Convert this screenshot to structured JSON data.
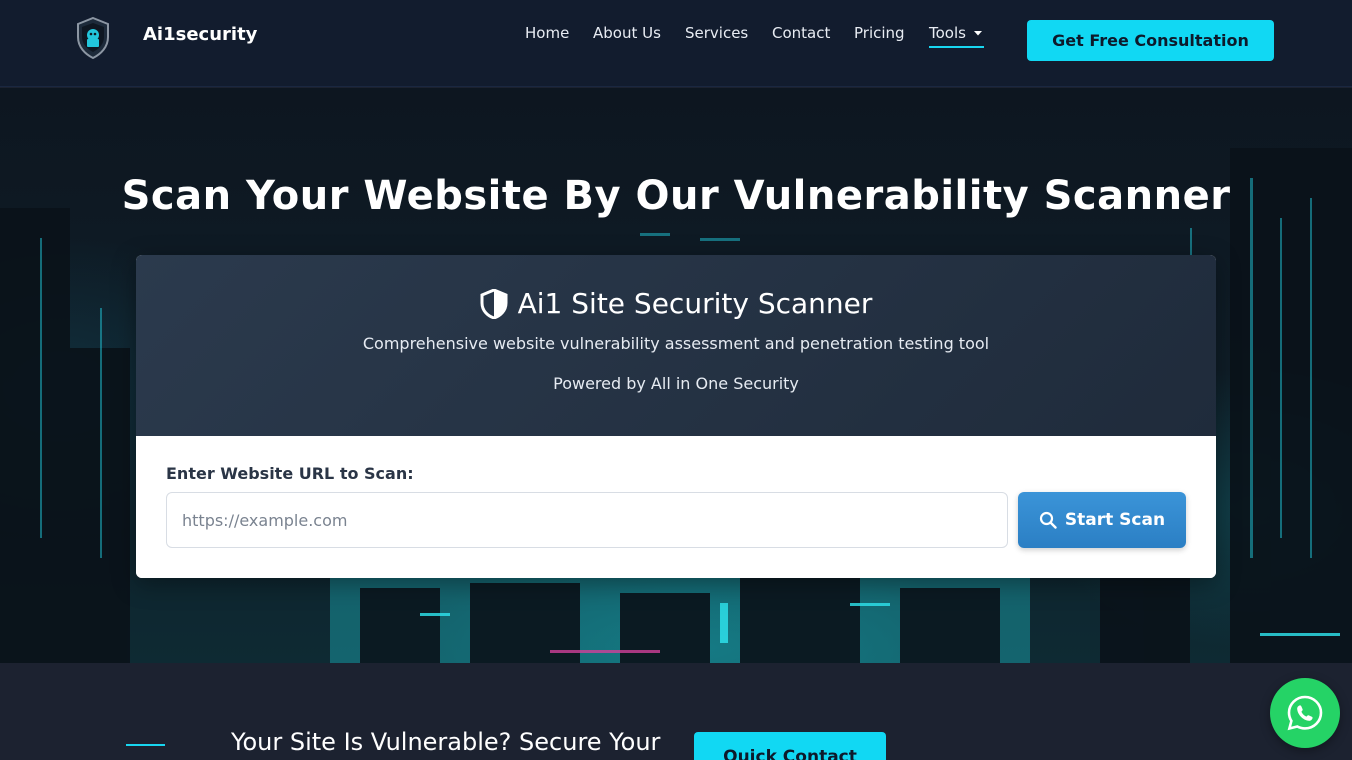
{
  "header": {
    "brand": "Ai1security",
    "nav": [
      "Home",
      "About Us",
      "Services",
      "Contact",
      "Pricing",
      "Tools"
    ],
    "cta_label": "Get Free Consultation"
  },
  "hero": {
    "title": "Scan Your Website By Our Vulnerability Scanner",
    "card": {
      "title": "Ai1 Site Security Scanner",
      "subtitle": "Comprehensive website vulnerability assessment and penetration testing tool",
      "powered": "Powered by All in One Security",
      "url_label": "Enter Website URL to Scan:",
      "url_placeholder": "https://example.com",
      "url_value": "",
      "scan_label": "Start Scan"
    }
  },
  "bottom": {
    "text": "Your Site Is Vulnerable? Secure Your",
    "quick_contact_label": "Quick Contact"
  },
  "icons": {
    "logo": "shield-logo-icon",
    "tools_caret": "caret-down-icon",
    "card_title": "shield-halved-icon",
    "scan": "search-icon",
    "float": "whatsapp-icon"
  },
  "colors": {
    "accent": "#11d8f3",
    "header_bg": "#121c2e",
    "scan_button": "#3b94d8",
    "whatsapp": "#25d366"
  }
}
